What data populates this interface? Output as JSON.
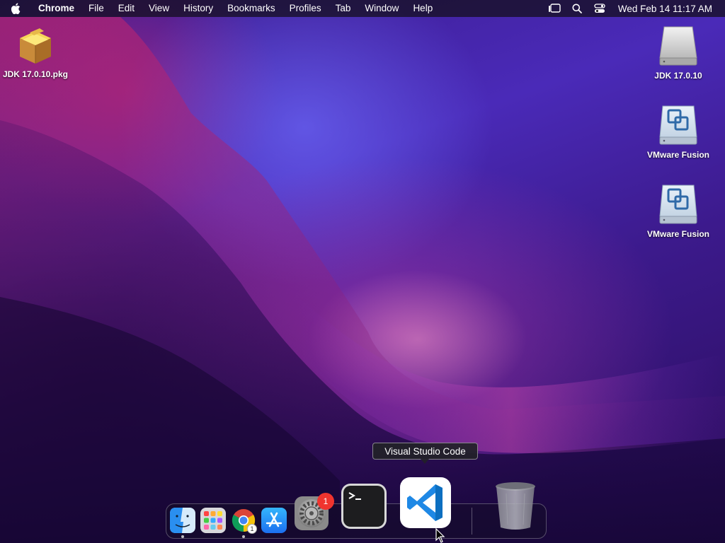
{
  "menubar": {
    "app_name": "Chrome",
    "items": [
      "File",
      "Edit",
      "View",
      "History",
      "Bookmarks",
      "Profiles",
      "Tab",
      "Window",
      "Help"
    ],
    "clock": "Wed Feb 14  11:17 AM",
    "status_icons": [
      "stage-manager-icon",
      "spotlight-icon",
      "control-center-icon"
    ]
  },
  "desktop": {
    "icons": [
      {
        "label": "JDK 17.0.10.pkg",
        "icon": "package-icon"
      },
      {
        "label": "JDK 17.0.10",
        "icon": "disk-image-icon"
      },
      {
        "label": "VMware Fusion",
        "icon": "vmware-disk-icon"
      },
      {
        "label": "VMware Fusion",
        "icon": "vmware-disk-icon"
      }
    ]
  },
  "dock": {
    "tooltip": "Visual Studio Code",
    "apps": [
      {
        "name": "Finder",
        "icon": "finder-icon",
        "running": true
      },
      {
        "name": "Launchpad",
        "icon": "launchpad-icon",
        "running": false
      },
      {
        "name": "Google Chrome",
        "icon": "chrome-icon",
        "running": true,
        "badge": "1"
      },
      {
        "name": "App Store",
        "icon": "app-store-icon",
        "running": false
      },
      {
        "name": "System Settings",
        "icon": "settings-gear-icon",
        "running": false,
        "badge": "1"
      },
      {
        "name": "Terminal",
        "icon": "terminal-icon",
        "running": false
      },
      {
        "name": "Visual Studio Code",
        "icon": "vscode-icon",
        "running": false
      },
      {
        "name": "Trash",
        "icon": "trash-icon",
        "running": false
      }
    ]
  },
  "colors": {
    "badge_red": "#f0342e",
    "vscode_blue": "#1e88e5",
    "appstore_blue": "#1c8cf5"
  }
}
